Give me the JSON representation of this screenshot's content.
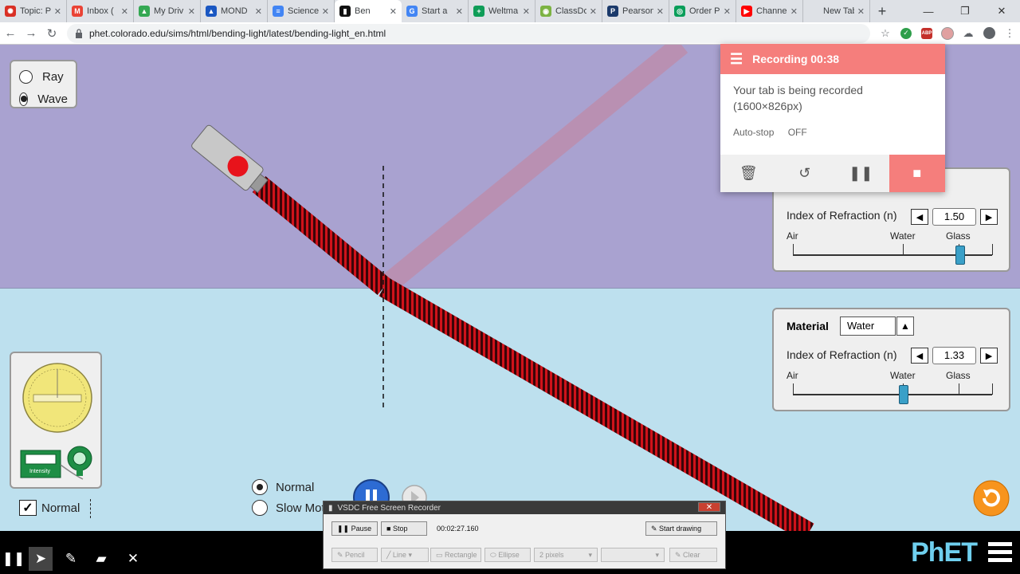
{
  "browser": {
    "tabs": [
      {
        "title": "Topic: Ph",
        "color": "#d93025",
        "glyph": "✺"
      },
      {
        "title": "Inbox (",
        "color": "#ea4335",
        "glyph": "M"
      },
      {
        "title": "My Driv",
        "color": "#34a853",
        "glyph": "▲"
      },
      {
        "title": "MOND",
        "color": "#1a57c2",
        "glyph": "▲"
      },
      {
        "title": "Science",
        "color": "#4285f4",
        "glyph": "≡"
      },
      {
        "title": "Ben",
        "color": "#111111",
        "glyph": "▮"
      },
      {
        "title": "Start a",
        "color": "#4285f4",
        "glyph": "G"
      },
      {
        "title": "Weltma",
        "color": "#0f9d58",
        "glyph": "+"
      },
      {
        "title": "ClassDo",
        "color": "#7cb342",
        "glyph": "◉"
      },
      {
        "title": "Pearson",
        "color": "#1b3a6b",
        "glyph": "P"
      },
      {
        "title": "Order P",
        "color": "#0a9e5a",
        "glyph": "◎"
      },
      {
        "title": "Channe",
        "color": "#ff0000",
        "glyph": "▶"
      },
      {
        "title": "New Tab",
        "color": "#dee1e6",
        "glyph": ""
      }
    ],
    "url": "phet.colorado.edu/sims/html/bending-light/latest/bending-light_en.html"
  },
  "sim": {
    "view_options": {
      "ray": "Ray",
      "wave": "Wave",
      "selected": "wave"
    },
    "top_material": {
      "ior_label": "Index of Refraction (n)",
      "ior_value": "1.50",
      "scale": {
        "left": "Air",
        "mid": "Water",
        "right": "Glass"
      }
    },
    "bottom_material": {
      "title": "Material",
      "selected": "Water",
      "ior_label": "Index of Refraction (n)",
      "ior_value": "1.33",
      "scale": {
        "left": "Air",
        "mid": "Water",
        "right": "Glass"
      }
    },
    "toolbox": {
      "intensity_label": "Intensity",
      "normal_label": "Normal",
      "normal_checked": true
    },
    "speed": {
      "normal": "Normal",
      "slow": "Slow Motion",
      "selected": "normal"
    }
  },
  "recording": {
    "header": "Recording 00:38",
    "message": "Your tab is being recorded (1600×826px)",
    "autostop_label": "Auto-stop",
    "autostop_value": "OFF"
  },
  "vsdc": {
    "title": "VSDC Free Screen Recorder",
    "pause": "Pause",
    "stop": "Stop",
    "time": "00:02:27.160",
    "start_drawing": "Start drawing",
    "pencil": "Pencil",
    "line": "Line",
    "rectangle": "Rectangle",
    "ellipse": "Ellipse",
    "pixels": "2 pixels",
    "clear": "Clear"
  },
  "brand": {
    "logo": "PhET"
  },
  "colors": {
    "air": "#a9a2d0",
    "water": "#bde0ee",
    "beam": "#d0121a",
    "accent": "#f57e7c"
  }
}
